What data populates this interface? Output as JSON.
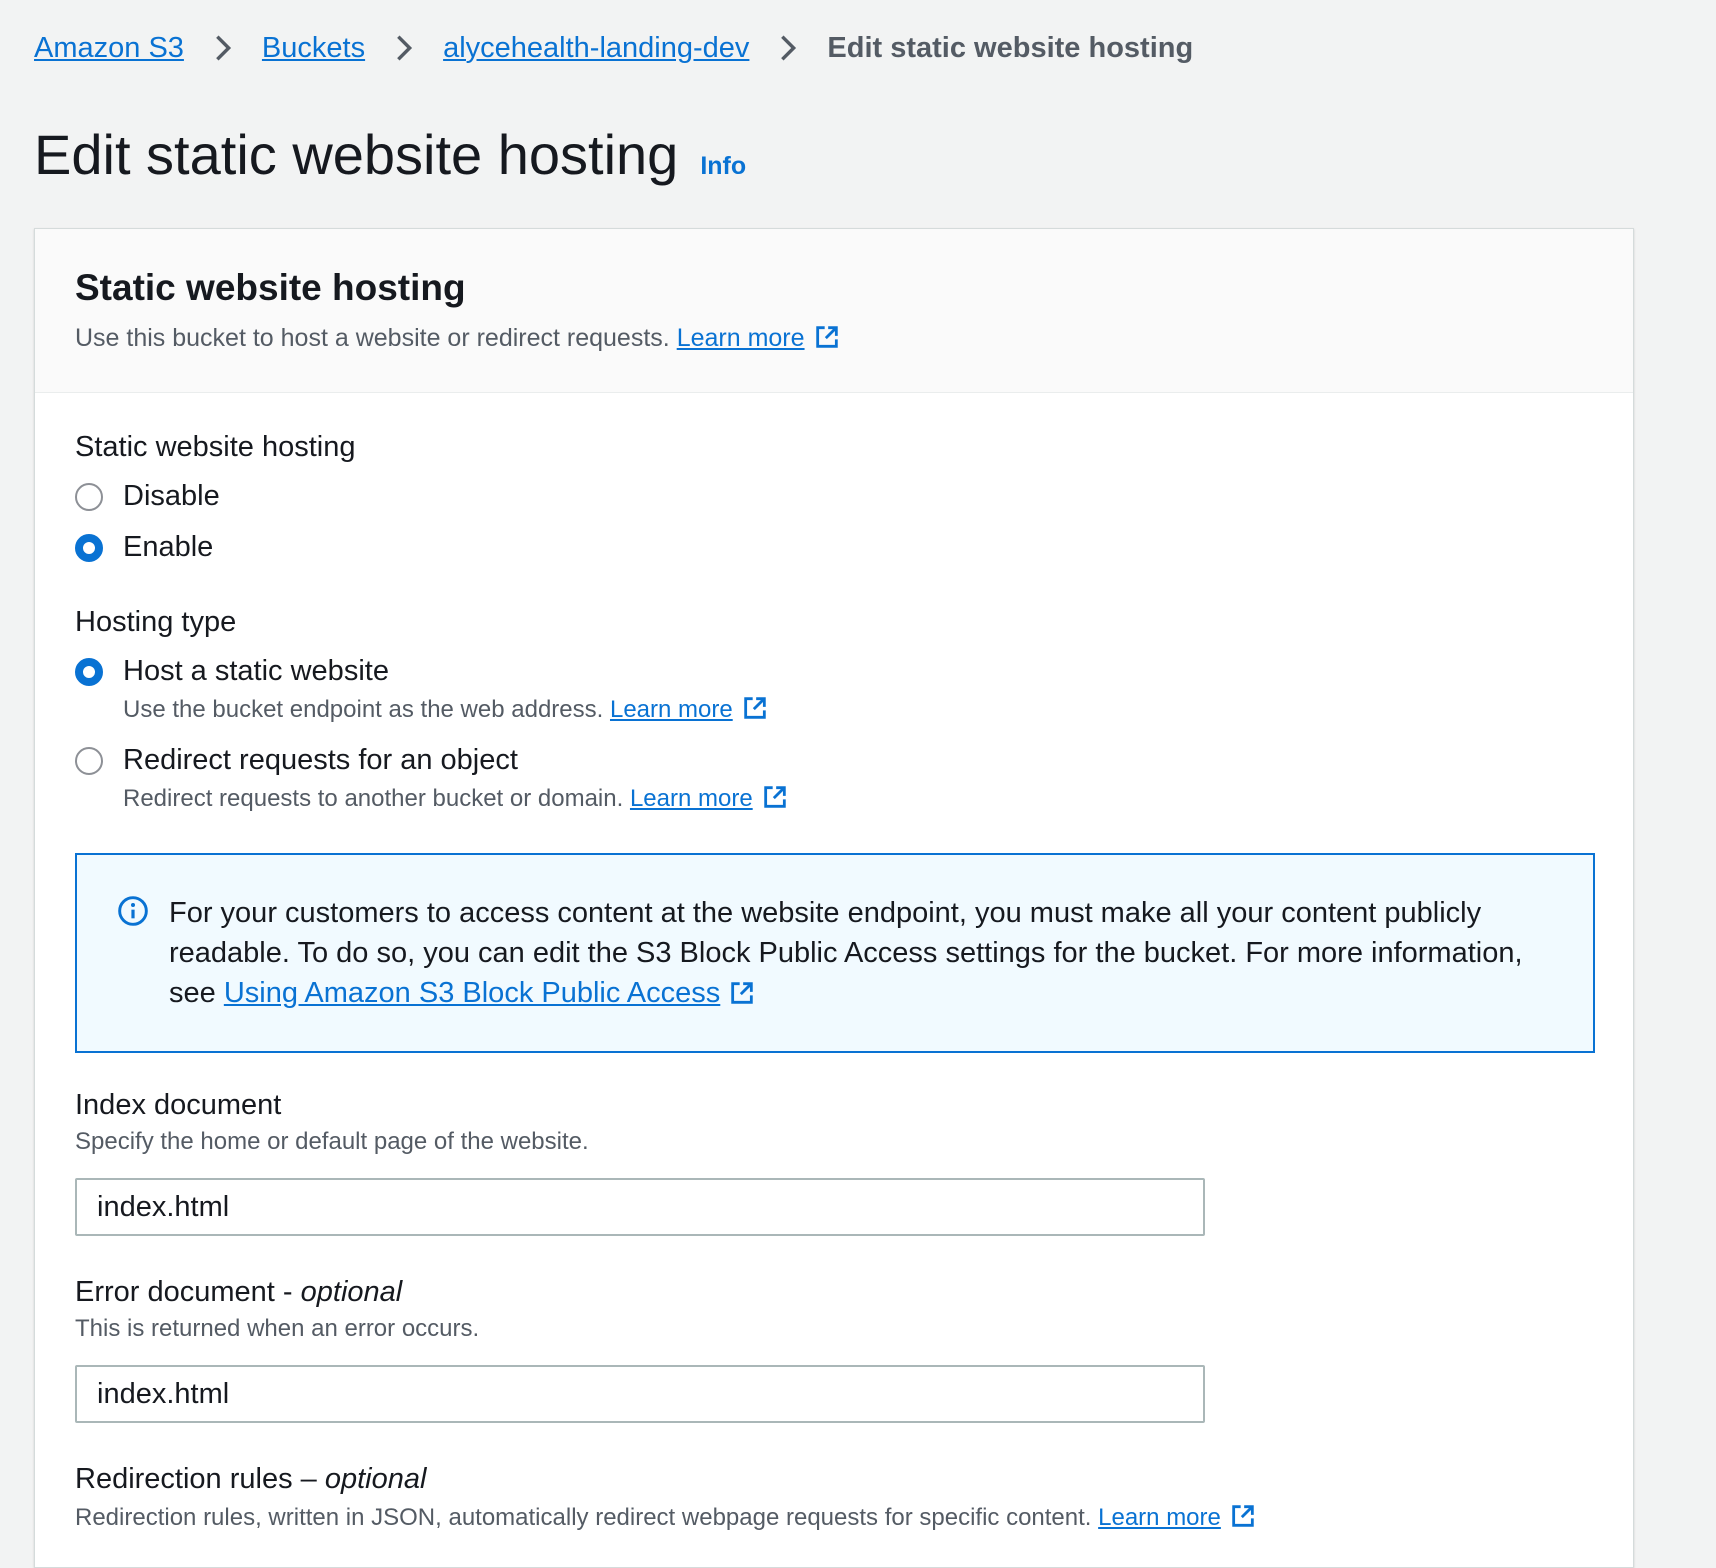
{
  "breadcrumb": {
    "items": [
      "Amazon S3",
      "Buckets",
      "alycehealth-landing-dev"
    ],
    "current": "Edit static website hosting"
  },
  "page": {
    "title": "Edit static website hosting",
    "info_label": "Info"
  },
  "container": {
    "title": "Static website hosting",
    "description": "Use this bucket to host a website or redirect requests.",
    "learn_more": "Learn more"
  },
  "hosting_toggle": {
    "label": "Static website hosting",
    "options": [
      {
        "label": "Disable",
        "checked": false
      },
      {
        "label": "Enable",
        "checked": true
      }
    ]
  },
  "hosting_type": {
    "label": "Hosting type",
    "options": [
      {
        "label": "Host a static website",
        "description": "Use the bucket endpoint as the web address.",
        "learn_more": "Learn more",
        "checked": true
      },
      {
        "label": "Redirect requests for an object",
        "description": "Redirect requests to another bucket or domain.",
        "learn_more": "Learn more",
        "checked": false
      }
    ]
  },
  "alert": {
    "text": "For your customers to access content at the website endpoint, you must make all your content publicly readable. To do so, you can edit the S3 Block Public Access settings for the bucket. For more information, see",
    "link": "Using Amazon S3 Block Public Access"
  },
  "index_document": {
    "label": "Index document",
    "description": "Specify the home or default page of the website.",
    "value": "index.html"
  },
  "error_document": {
    "label": "Error document - ",
    "optional": "optional",
    "description": "This is returned when an error occurs.",
    "value": "index.html"
  },
  "redirection_rules": {
    "label": "Redirection rules – ",
    "optional": "optional",
    "description": "Redirection rules, written in JSON, automatically redirect webpage requests for specific content.",
    "learn_more": "Learn more"
  },
  "colors": {
    "link": "#0972d3",
    "alert_bg": "#f1faff",
    "page_bg": "#f2f3f3"
  },
  "icons": [
    "chevron-right-icon",
    "external-link-icon",
    "info-circle-icon"
  ]
}
